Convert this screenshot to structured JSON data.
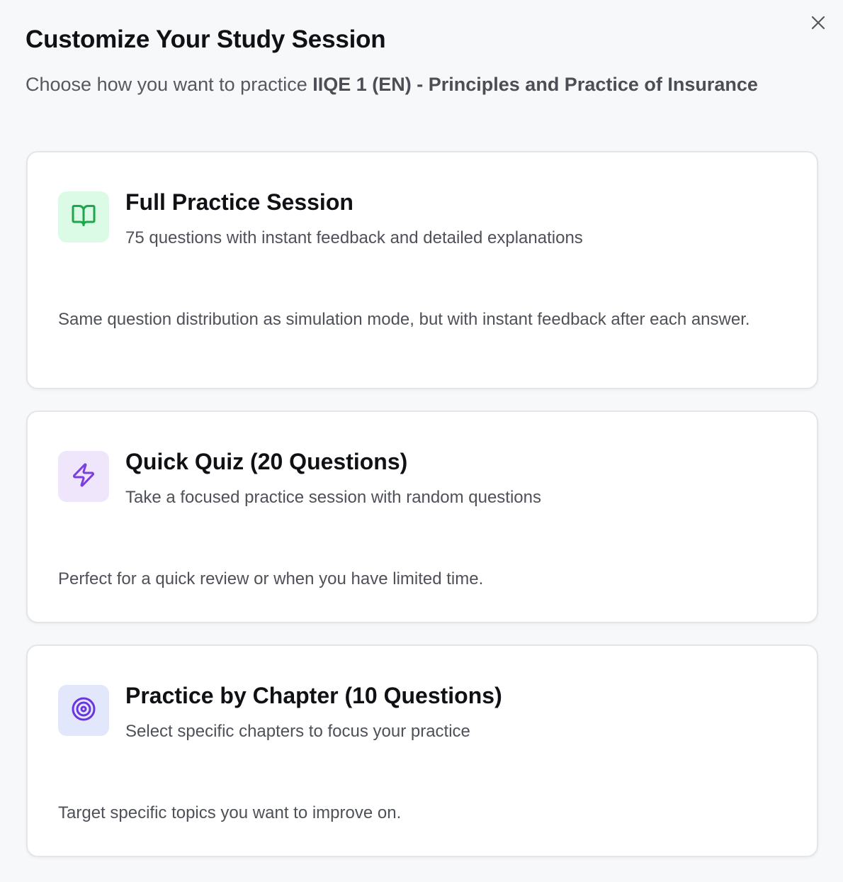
{
  "dialog": {
    "title": "Customize Your Study Session",
    "subtitle_prefix": "Choose how you want to practice ",
    "subtitle_course": "IIQE 1 (EN) - Principles and Practice of Insurance",
    "close_icon": "close-icon"
  },
  "options": [
    {
      "title": "Full Practice Session",
      "subtitle": "75 questions with instant feedback and detailed explanations",
      "description": "Same question distribution as simulation mode, but with instant feedback after each answer.",
      "icon": "book-open-icon",
      "icon_color": "#1ea64a",
      "icon_bg": "#dcfbe6"
    },
    {
      "title": "Quick Quiz (20 Questions)",
      "subtitle": "Take a focused practice session with random questions",
      "description": "Perfect for a quick review or when you have limited time.",
      "icon": "lightning-icon",
      "icon_color": "#7b3fe0",
      "icon_bg": "#efe6fb"
    },
    {
      "title": "Practice by Chapter (10 Questions)",
      "subtitle": "Select specific chapters to focus your practice",
      "description": "Target specific topics you want to improve on.",
      "icon": "target-icon",
      "icon_color": "#5b3fe0",
      "icon_bg": "#e3e7fb"
    }
  ]
}
